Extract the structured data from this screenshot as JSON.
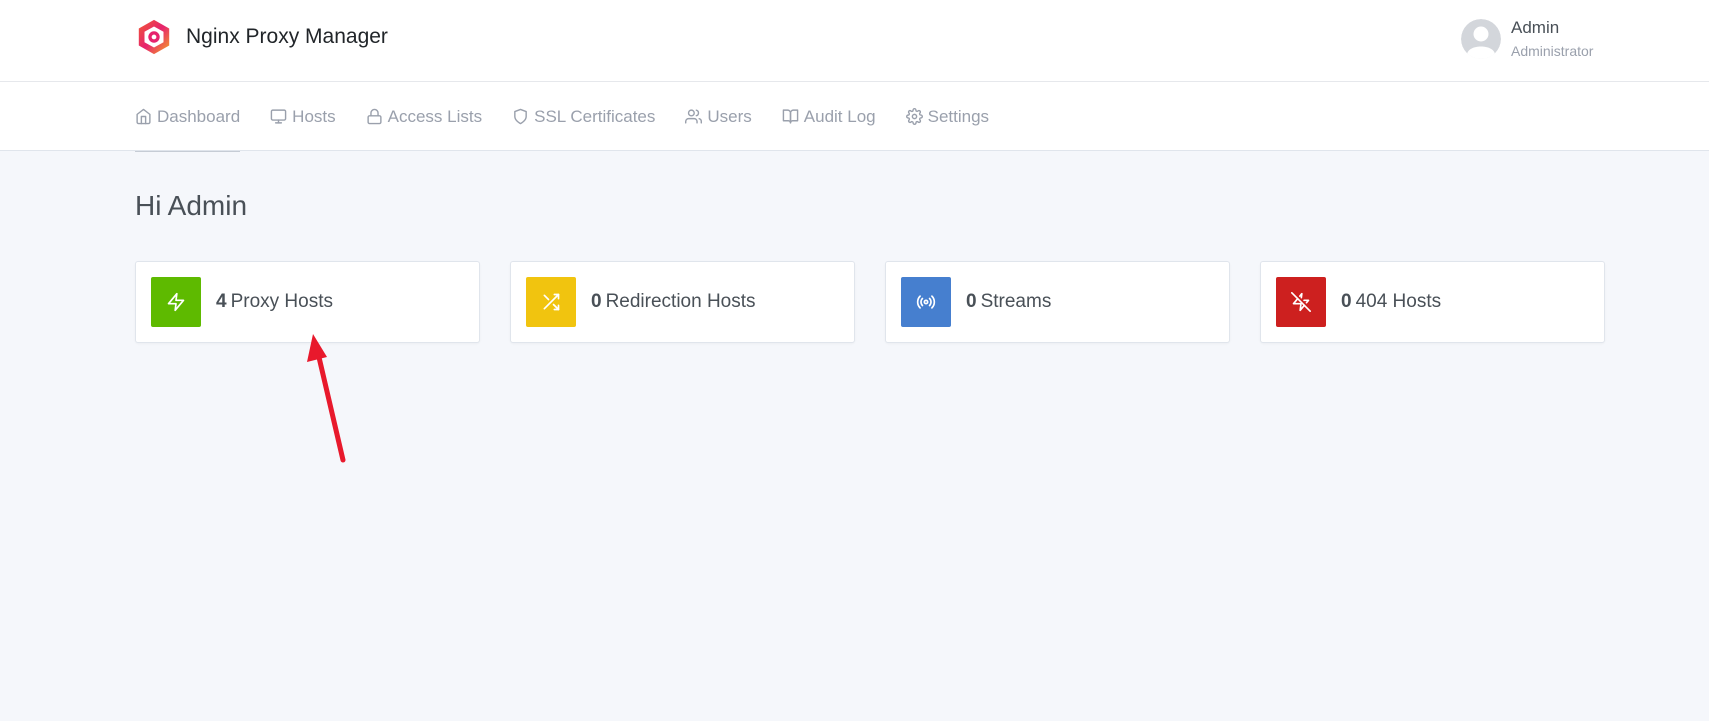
{
  "app": {
    "title": "Nginx Proxy Manager"
  },
  "user": {
    "name": "Admin",
    "role": "Administrator",
    "avatar_icon": "user-avatar-icon"
  },
  "nav": {
    "items": [
      {
        "label": "Dashboard",
        "icon": "home-icon",
        "active": true
      },
      {
        "label": "Hosts",
        "icon": "monitor-icon"
      },
      {
        "label": "Access Lists",
        "icon": "lock-icon"
      },
      {
        "label": "SSL Certificates",
        "icon": "shield-icon"
      },
      {
        "label": "Users",
        "icon": "users-icon"
      },
      {
        "label": "Audit Log",
        "icon": "book-icon"
      },
      {
        "label": "Settings",
        "icon": "gear-icon"
      }
    ]
  },
  "main": {
    "greeting": "Hi Admin",
    "cards": [
      {
        "count": "4",
        "label": "Proxy Hosts",
        "color": "#5eba00",
        "icon": "zap-icon"
      },
      {
        "count": "0",
        "label": "Redirection Hosts",
        "color": "#f1c40f",
        "icon": "shuffle-icon"
      },
      {
        "count": "0",
        "label": "Streams",
        "color": "#467fcf",
        "icon": "radio-icon"
      },
      {
        "count": "0",
        "label": "404 Hosts",
        "color": "#cd201f",
        "icon": "zap-off-icon"
      }
    ]
  },
  "colors": {
    "annotation_arrow": "#e8192c",
    "page_background": "#f5f7fb"
  }
}
